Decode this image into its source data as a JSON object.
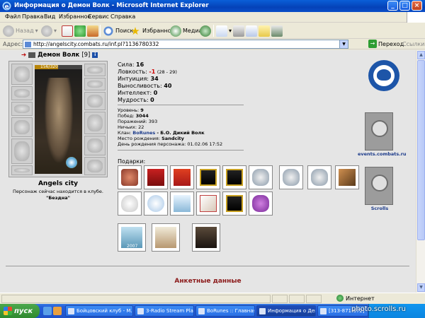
{
  "window": {
    "title": "Информация о Демон Волк - Microsoft Internet Explorer"
  },
  "menu": [
    "Файл",
    "Правка",
    "Вид",
    "Избранное",
    "Сервис",
    "Справка"
  ],
  "toolbar": {
    "back": "Назад",
    "search": "Поиск",
    "favorites": "Избранное",
    "media": "Медиа"
  },
  "address": {
    "label": "Адрес:",
    "url": "http://angelscity.combats.ru/inf.pl?1136780332",
    "go": "Переход",
    "links": "Ссылки"
  },
  "character": {
    "name": "Демон Волк",
    "level": "[9]",
    "hp": "156/320",
    "hp_fraction": 0.49,
    "city": "Angels city",
    "location_note": "Персонаж сейчас находится в клубе.",
    "location_place": "\"Бездна\""
  },
  "stats": [
    {
      "label": "Сила:",
      "value": "16",
      "extra": "",
      "red": false
    },
    {
      "label": "Ловкость:",
      "value": "-1",
      "extra": "(28 - 29)",
      "red": true
    },
    {
      "label": "Интуиция:",
      "value": "34",
      "extra": "",
      "red": false
    },
    {
      "label": "Выносливость:",
      "value": "40",
      "extra": "",
      "red": false
    },
    {
      "label": "Интеллект:",
      "value": "0",
      "extra": "",
      "red": false
    },
    {
      "label": "Мудрость:",
      "value": "0",
      "extra": "",
      "red": false
    }
  ],
  "info": {
    "level_label": "Уровень:",
    "level": "9",
    "wins_label": "Побед:",
    "wins": "3044",
    "losses_label": "Поражений:",
    "losses": "393",
    "draws_label": "Ничьих:",
    "draws": "22",
    "clan_label": "Клан:",
    "clan": "BoRunes",
    "clan_rank": "- Б.О. Дикий Волк",
    "birthplace_label": "Место рождения:",
    "birthplace": "Sandcity",
    "birthday_label": "День рождения персонажа:",
    "birthday": "01.02.06 17:52"
  },
  "gifts": {
    "label": "Подарки:"
  },
  "logos": {
    "events_caption": "events.combats.ru",
    "scrolls_caption": "Scrolls",
    "tile_year": "2007"
  },
  "anketa": "Анкетные данные",
  "status": {
    "zone": "Интернет"
  },
  "taskbar": {
    "start": "пуск",
    "tasks": [
      "Бойцовский клуб - М...",
      "3-Radio Stream Playe...",
      "BoRunes :: Главная ...",
      "Информация о Демо...",
      "[313-871-672] - Он..."
    ]
  },
  "watermark": "photo.scrolls.ru"
}
